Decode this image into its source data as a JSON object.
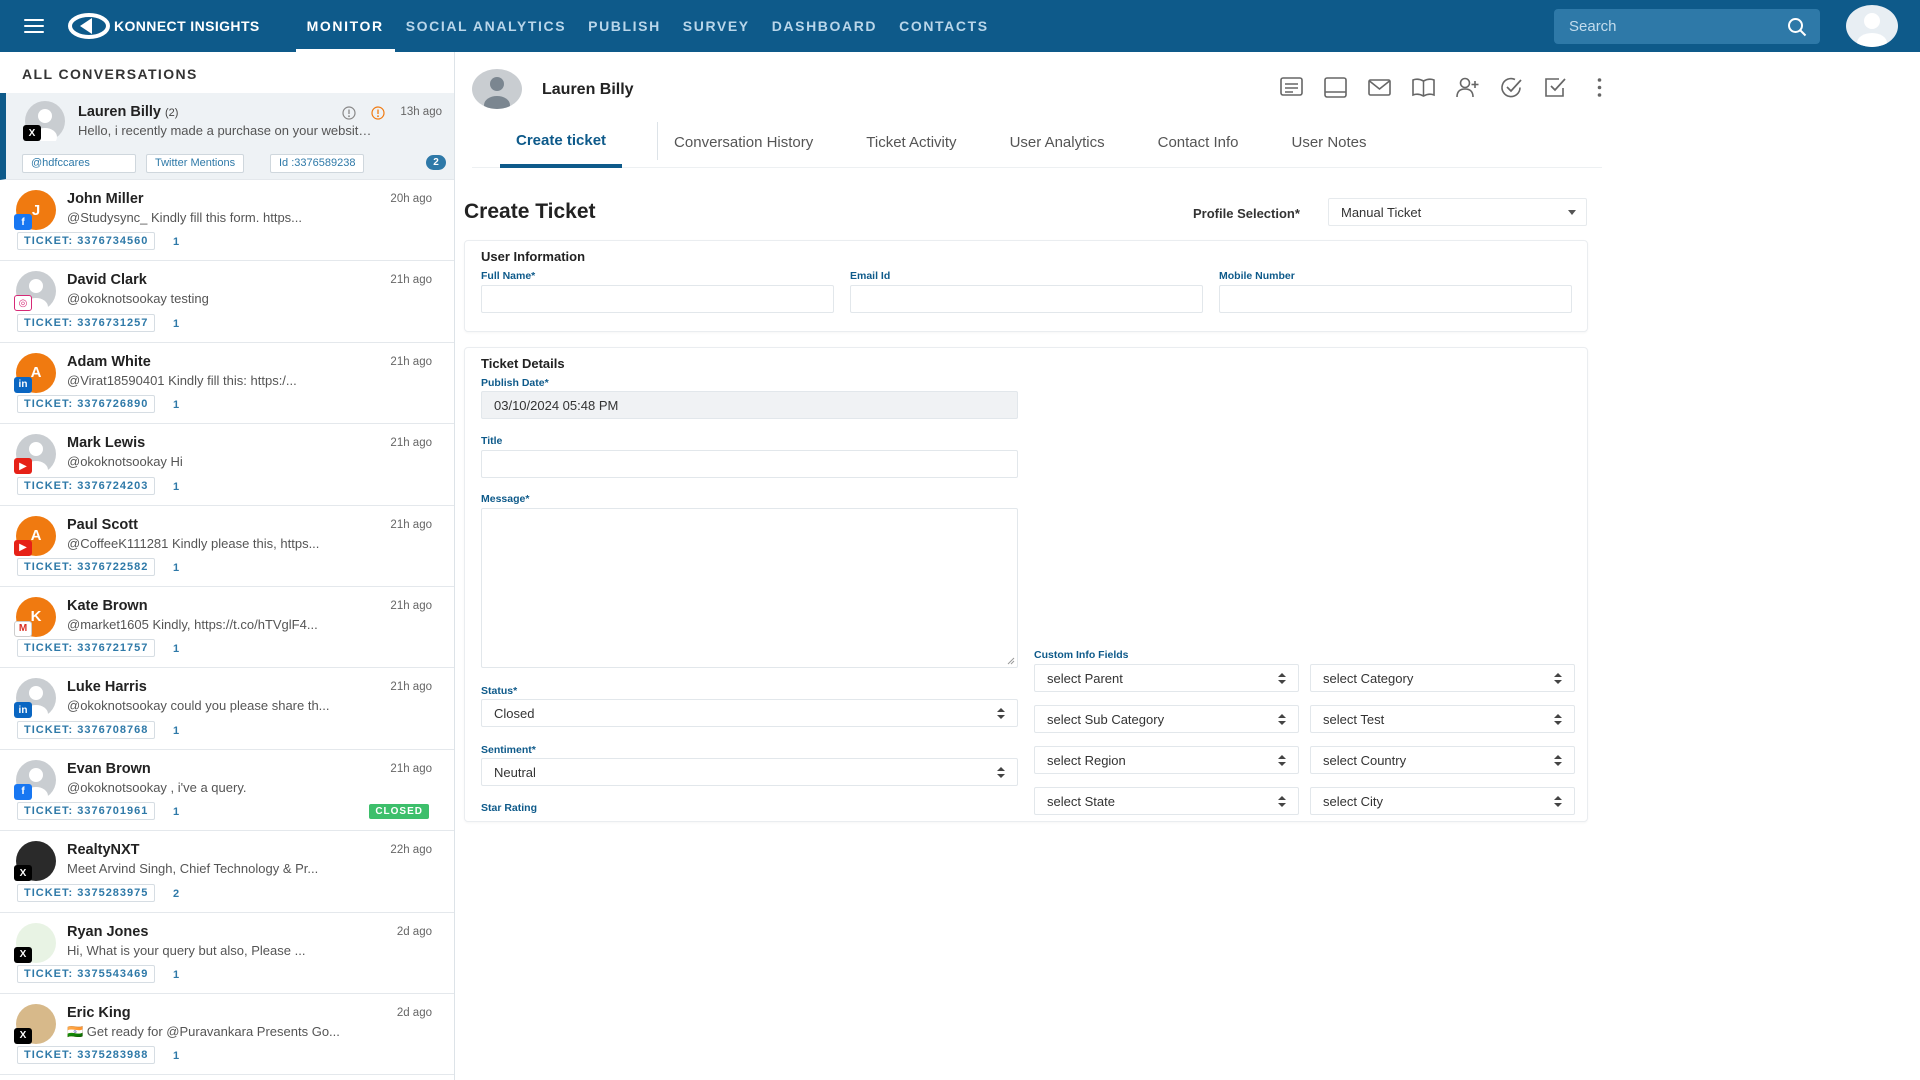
{
  "brand": {
    "name": "KONNECT INSIGHTS"
  },
  "nav": [
    {
      "label": "MONITOR",
      "active": true
    },
    {
      "label": "SOCIAL ANALYTICS",
      "active": false
    },
    {
      "label": "PUBLISH",
      "active": false
    },
    {
      "label": "SURVEY",
      "active": false
    },
    {
      "label": "DASHBOARD",
      "active": false
    },
    {
      "label": "CONTACTS",
      "active": false
    }
  ],
  "search": {
    "placeholder": "Search"
  },
  "left_panel": {
    "title": "ALL CONVERSATIONS",
    "active": {
      "name": "Lauren Billy",
      "count": "(2)",
      "time": "13h ago",
      "message": "Hello, i recently made a purchase on your website but unfo...",
      "chips": [
        "@hdfccares",
        "Twitter Mentions",
        "Id :3376589238"
      ],
      "badge": "2",
      "platform": "x"
    },
    "conversations": [
      {
        "name": "John Miller",
        "time": "20h ago",
        "message": "@Studysync_ Kindly fill this form. https...",
        "ticket": "TICKET: 3376734560",
        "count": "1",
        "initial": "J",
        "avatar": "orange",
        "platform": "fb"
      },
      {
        "name": "David Clark",
        "time": "21h ago",
        "message": "@okoknotsookay testing",
        "ticket": "TICKET: 3376731257",
        "count": "1",
        "initial": "",
        "avatar": "grey",
        "platform": "ig"
      },
      {
        "name": "Adam White",
        "time": "21h ago",
        "message": "@Virat18590401 Kindly fill this: https:/...",
        "ticket": "TICKET: 3376726890",
        "count": "1",
        "initial": "A",
        "avatar": "orange",
        "platform": "in"
      },
      {
        "name": "Mark Lewis",
        "time": "21h ago",
        "message": "@okoknotsookay Hi",
        "ticket": "TICKET: 3376724203",
        "count": "1",
        "initial": "",
        "avatar": "grey",
        "platform": "yt"
      },
      {
        "name": "Paul Scott",
        "time": "21h ago",
        "message": "@CoffeeK111281 Kindly please this, https...",
        "ticket": "TICKET: 3376722582",
        "count": "1",
        "initial": "A",
        "avatar": "orange",
        "platform": "yt"
      },
      {
        "name": "Kate Brown",
        "time": "21h ago",
        "message": "@market1605 Kindly, https://t.co/hTVglF4...",
        "ticket": "TICKET: 3376721757",
        "count": "1",
        "initial": "K",
        "avatar": "orange",
        "platform": "gm"
      },
      {
        "name": "Luke Harris",
        "time": "21h ago",
        "message": "@okoknotsookay could you please share th...",
        "ticket": "TICKET: 3376708768",
        "count": "1",
        "initial": "",
        "avatar": "grey",
        "platform": "in"
      },
      {
        "name": "Evan Brown",
        "time": "21h ago",
        "message": "@okoknotsookay , i've a query.",
        "ticket": "TICKET: 3376701961",
        "count": "1",
        "initial": "",
        "avatar": "grey",
        "platform": "fb",
        "status": "CLOSED"
      },
      {
        "name": "RealtyNXT",
        "time": "22h ago",
        "message": "Meet Arvind Singh, Chief Technology & Pr...",
        "ticket": "TICKET: 3375283975",
        "count": "2",
        "initial": "",
        "avatar": "dark",
        "platform": "x"
      },
      {
        "name": "Ryan Jones",
        "time": "2d ago",
        "message": "Hi, What is your query but also, Please ...",
        "ticket": "TICKET: 3375543469",
        "count": "1",
        "initial": "",
        "avatar": "green",
        "platform": "x"
      },
      {
        "name": "Eric King",
        "time": "2d ago",
        "message": "🇮🇳 Get ready for @Puravankara Presents Go...",
        "ticket": "TICKET: 3375283988",
        "count": "1",
        "initial": "",
        "avatar": "pic",
        "platform": "x"
      }
    ]
  },
  "header": {
    "name": "Lauren Billy",
    "actions": [
      "notes-icon",
      "tablet-icon",
      "mail-icon",
      "book-icon",
      "add-user-icon",
      "check-circle-icon",
      "check-square-icon",
      "more-vertical-icon"
    ]
  },
  "tabs": [
    {
      "label": "Create ticket",
      "active": true
    },
    {
      "label": "Conversation History",
      "active": false
    },
    {
      "label": "Ticket Activity",
      "active": false
    },
    {
      "label": "User Analytics",
      "active": false
    },
    {
      "label": "Contact Info",
      "active": false
    },
    {
      "label": "User Notes",
      "active": false
    }
  ],
  "create_ticket": {
    "title": "Create Ticket",
    "profile_label": "Profile Selection*",
    "profile_value": "Manual Ticket",
    "user_info": {
      "title": "User Information",
      "full_name_label": "Full Name*",
      "email_label": "Email Id",
      "mobile_label": "Mobile Number"
    },
    "ticket_details": {
      "title": "Ticket Details",
      "publish_label": "Publish Date*",
      "publish_value": "03/10/2024 05:48 PM",
      "title_label": "Title",
      "message_label": "Message*",
      "status_label": "Status*",
      "status_value": "Closed",
      "sentiment_label": "Sentiment*",
      "sentiment_value": "Neutral",
      "star_label": "Star Rating",
      "custom_label": "Custom Info Fields",
      "custom_selects": [
        "select Parent",
        "select Category",
        "select Sub Category",
        "select Test",
        "select Region",
        "select Country",
        "select State",
        "select City"
      ]
    }
  },
  "colors": {
    "primary": "#0e5a8a",
    "accent": "#2e79a8",
    "closed": "#3dbf6b",
    "orange": "#f07a10"
  }
}
